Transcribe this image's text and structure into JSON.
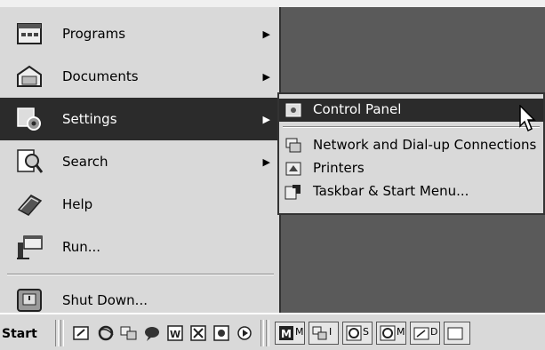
{
  "start_menu": {
    "items": [
      {
        "label": "Programs",
        "icon": "programs-icon",
        "has_submenu": true
      },
      {
        "label": "Documents",
        "icon": "documents-icon",
        "has_submenu": true
      },
      {
        "label": "Settings",
        "icon": "settings-icon",
        "has_submenu": true,
        "active": true
      },
      {
        "label": "Search",
        "icon": "search-icon",
        "has_submenu": true
      },
      {
        "label": "Help",
        "icon": "help-icon",
        "has_submenu": false
      },
      {
        "label": "Run...",
        "icon": "run-icon",
        "has_submenu": false
      }
    ],
    "shutdown": {
      "label": "Shut Down...",
      "icon": "shutdown-icon"
    },
    "arrow_glyph": "▶"
  },
  "settings_submenu": {
    "items": [
      {
        "label": "Control Panel",
        "icon": "control-panel-icon",
        "active": true
      },
      {
        "label": "Network and Dial-up Connections",
        "icon": "network-icon"
      },
      {
        "label": "Printers",
        "icon": "printers-icon"
      },
      {
        "label": "Taskbar & Start Menu...",
        "icon": "taskbar-settings-icon"
      }
    ]
  },
  "taskbar": {
    "start_label": "Start",
    "task_buttons": [
      {
        "label": "M",
        "icon": "media-window-icon"
      },
      {
        "label": "I",
        "icon": "network-window-icon"
      },
      {
        "label": "S",
        "icon": "browser-window-icon"
      },
      {
        "label": "M",
        "icon": "browser-window-icon"
      },
      {
        "label": "D",
        "icon": "folder-window-icon"
      }
    ]
  },
  "colors": {
    "menu_bg": "#d9d9d9",
    "highlight": "#2b2b2b",
    "desktop": "#5a5a5a"
  }
}
